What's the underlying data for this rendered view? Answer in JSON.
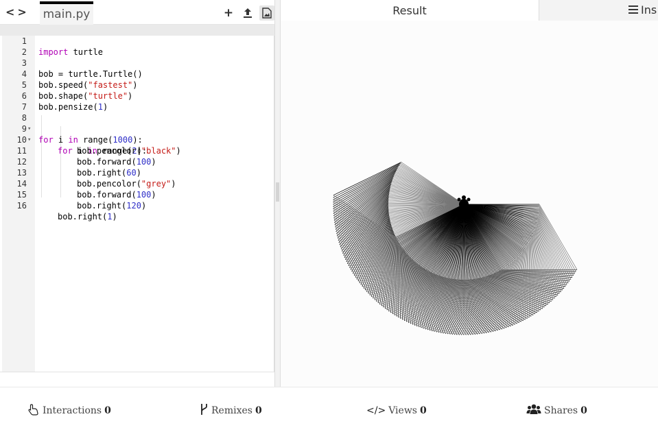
{
  "nav": {
    "back_label": "<",
    "forward_label": ">"
  },
  "editor": {
    "file_tab": "main.py",
    "toolbar": {
      "add_icon": "+",
      "upload_icon": "⬆",
      "image_icon": "🖼"
    }
  },
  "code": [
    {
      "n": "1"
    },
    {
      "n": "2"
    },
    {
      "n": "3"
    },
    {
      "n": "4"
    },
    {
      "n": "5"
    },
    {
      "n": "6"
    },
    {
      "n": "7"
    },
    {
      "n": "8"
    },
    {
      "n": "9"
    },
    {
      "n": "10"
    },
    {
      "n": "11"
    },
    {
      "n": "12"
    },
    {
      "n": "13"
    },
    {
      "n": "14"
    },
    {
      "n": "15"
    },
    {
      "n": "16"
    }
  ],
  "code_tokens": {
    "l1": [
      "import",
      " turtle"
    ],
    "l3": "bob = turtle.Turtle()",
    "l4": [
      "bob.speed(",
      "\"fastest\"",
      ")"
    ],
    "l5": [
      "bob.shape(",
      "\"turtle\"",
      ")"
    ],
    "l6": [
      "bob.pensize(",
      "1",
      ")"
    ],
    "l8": [
      "for",
      " i ",
      "in",
      " range(",
      "1000",
      "):"
    ],
    "l9": [
      "for",
      " i ",
      "in",
      " range(",
      "2",
      "):"
    ],
    "l10": [
      "bob.pencolor(",
      "\"black\"",
      ")"
    ],
    "l11": [
      "bob.forward(",
      "100",
      ")"
    ],
    "l12": [
      "bob.right(",
      "60",
      ")"
    ],
    "l13": [
      "bob.pencolor(",
      "\"grey\"",
      ")"
    ],
    "l14": [
      "bob.forward(",
      "100",
      ")"
    ],
    "l15": [
      "bob.right(",
      "120",
      ")"
    ],
    "l16": [
      "bob.right(",
      "1",
      ")"
    ]
  },
  "right": {
    "tab_result": "Result",
    "tab_instructions": "Ins"
  },
  "footer": {
    "interactions_label": "Interactions",
    "interactions_count": "0",
    "remixes_label": "Remixes",
    "remixes_count": "0",
    "views_label": "Views",
    "views_count": "0",
    "shares_label": "Shares",
    "shares_count": "0"
  },
  "colors": {
    "keyword": "#b000b5",
    "number": "#2d2dc8",
    "string": "#c41a16"
  },
  "icons": [
    "chevron-left-icon",
    "chevron-right-icon",
    "plus-icon",
    "upload-icon",
    "image-icon",
    "list-icon",
    "pointer-icon",
    "branch-icon",
    "code-icon",
    "users-icon",
    "turtle-icon"
  ]
}
